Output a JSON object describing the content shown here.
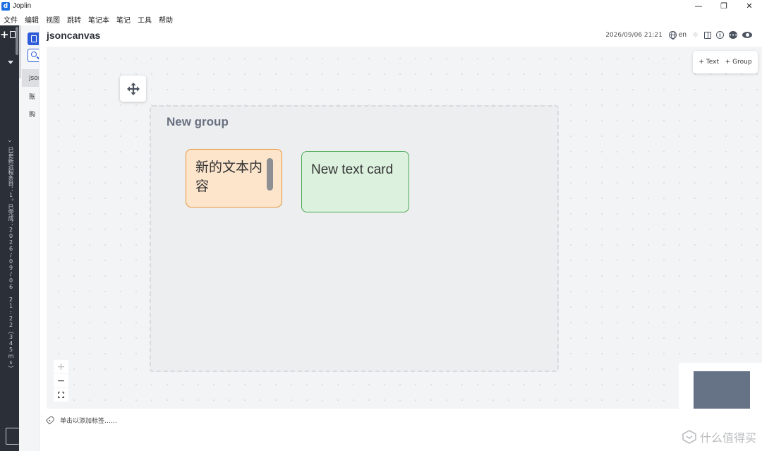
{
  "window": {
    "title": "Joplin",
    "logo_letter": "d",
    "controls": {
      "minimize": "—",
      "restore": "❐",
      "close": "✕"
    }
  },
  "menu": [
    "文件",
    "编辑",
    "视图",
    "跳转",
    "笔记本",
    "笔记",
    "工具",
    "帮助"
  ],
  "sidebar": {
    "new_button": "+",
    "sync_status": "已更新远程条目：1。已完成：2026/09/06 21:22（345ms）",
    "colors": {
      "background": "#2b3038"
    }
  },
  "notelist": {
    "items": [
      {
        "label": "jsoncanvas",
        "selected": true
      },
      {
        "label": "账",
        "selected": false
      },
      {
        "label": "购",
        "selected": false
      }
    ],
    "accent": "#2e5bd8"
  },
  "editor": {
    "title": "jsoncanvas",
    "datetime": "2026/09/06 21:21",
    "language": "en",
    "icons": [
      "globe-icon",
      "spellcheck-icon",
      "layout-toggle-icon",
      "info-icon",
      "comment-icon",
      "eye-icon"
    ]
  },
  "canvas": {
    "toolbar": {
      "add_text": "+ Text",
      "add_group": "+ Group"
    },
    "group": {
      "label": "New group"
    },
    "cards": [
      {
        "text": "新的文本内容",
        "color": "orange",
        "border": "#e8953a",
        "fill": "#fde5cc"
      },
      {
        "text": "New text card",
        "color": "green",
        "border": "#4aa656",
        "fill": "#dcf2de"
      }
    ],
    "zoom": {
      "in": "+",
      "out": "−"
    },
    "minimap": {
      "view_color": "#667387"
    }
  },
  "tags": {
    "placeholder": "单击以添加标签……"
  },
  "watermark": {
    "text": "什么值得买"
  }
}
